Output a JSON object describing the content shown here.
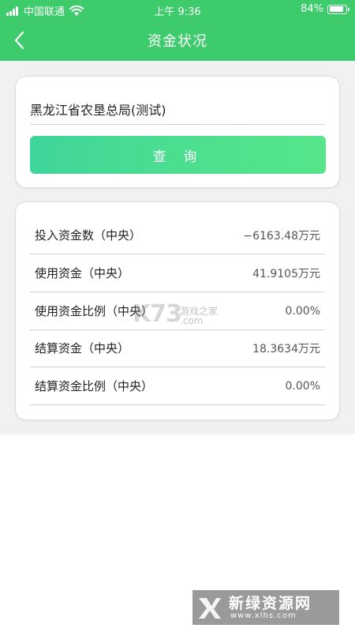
{
  "status_bar": {
    "carrier": "中国联通",
    "time": "上午 9:36",
    "battery": "84%"
  },
  "nav": {
    "title": "资金状况"
  },
  "query_card": {
    "unit": "黑龙江省农垦总局(测试)",
    "button_label": "查 询"
  },
  "results": [
    {
      "label": "投入资金数（中央）",
      "value": "−6163.48万元"
    },
    {
      "label": "使用资金（中央）",
      "value": "41.9105万元"
    },
    {
      "label": "使用资金比例（中央）",
      "value": "0.00%"
    },
    {
      "label": "结算资金（中央）",
      "value": "18.3634万元"
    },
    {
      "label": "结算资金比例（中央）",
      "value": "0.00%"
    }
  ],
  "watermarks": {
    "k73_logo": "K73",
    "k73_text": "游戏之家",
    "k73_domain": ".com",
    "xlhs_title": "新绿资源网",
    "xlhs_url": "www.xlhs.com"
  },
  "colors": {
    "header_green": "#3dcb6c",
    "button_gradient_start": "#3fd59a",
    "button_gradient_end": "#56e58a"
  }
}
